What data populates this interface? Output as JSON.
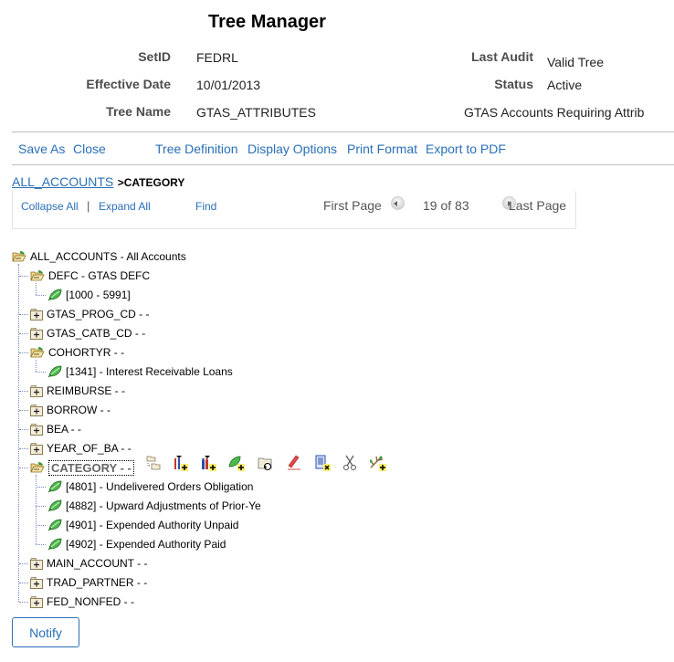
{
  "page": {
    "title": "Tree Manager"
  },
  "header": {
    "setid_label": "SetID",
    "setid_value": "FEDRL",
    "effdate_label": "Effective Date",
    "effdate_value": "10/01/2013",
    "treename_label": "Tree Name",
    "treename_value": "GTAS_ATTRIBUTES",
    "lastaudit_label": "Last Audit",
    "lastaudit_value": "Valid Tree",
    "status_label": "Status",
    "status_value": "Active",
    "description": "GTAS Accounts Requiring Attrib"
  },
  "actions": {
    "save_as": "Save As",
    "close": "Close",
    "tree_definition": "Tree Definition",
    "display_options": "Display Options",
    "print_format": "Print Format",
    "export_pdf": "Export to PDF"
  },
  "breadcrumb": {
    "root": "ALL_ACCOUNTS",
    "current": ">CATEGORY"
  },
  "tree_toolbar": {
    "collapse_all": "Collapse All",
    "separator": "|",
    "expand_all": "Expand All",
    "find": "Find",
    "first_page": "First Page",
    "page_info": "19 of 83",
    "last_page": "Last Page"
  },
  "tree": {
    "root": "ALL_ACCOUNTS - All Accounts",
    "nodes": [
      {
        "label": "DEFC - GTAS DEFC",
        "state": "open"
      },
      {
        "label": "[1000 - 5991]",
        "state": "leaf"
      },
      {
        "label": "GTAS_PROG_CD - -",
        "state": "closed"
      },
      {
        "label": "GTAS_CATB_CD - -",
        "state": "closed"
      },
      {
        "label": "COHORTYR - -",
        "state": "open"
      },
      {
        "label": "[1341] - Interest Receivable Loans",
        "state": "leaf"
      },
      {
        "label": "REIMBURSE - -",
        "state": "closed"
      },
      {
        "label": "BORROW - -",
        "state": "closed"
      },
      {
        "label": "BEA - -",
        "state": "closed"
      },
      {
        "label": "YEAR_OF_BA - -",
        "state": "closed"
      },
      {
        "label": "CATEGORY - -",
        "state": "open-selected"
      },
      {
        "label": "[4801] - Undelivered Orders Obligation",
        "state": "leaf"
      },
      {
        "label": "[4882] - Upward Adjustments of Prior-Ye",
        "state": "leaf"
      },
      {
        "label": "[4901] - Expended Authority Unpaid",
        "state": "leaf"
      },
      {
        "label": "[4902] - Expended Authority Paid",
        "state": "leaf"
      },
      {
        "label": "MAIN_ACCOUNT - -",
        "state": "closed"
      },
      {
        "label": "TRAD_PARTNER - -",
        "state": "closed"
      },
      {
        "label": "FED_NONFED - -",
        "state": "closed"
      }
    ],
    "node_actions": [
      "cut-paste-node-icon",
      "insert-child-node-icon",
      "insert-sibling-node-icon",
      "insert-detail-icon",
      "move-folder-icon",
      "edit-data-icon",
      "delete-node-icon",
      "cut-icon",
      "add-branch-icon"
    ]
  },
  "footer": {
    "notify": "Notify"
  }
}
